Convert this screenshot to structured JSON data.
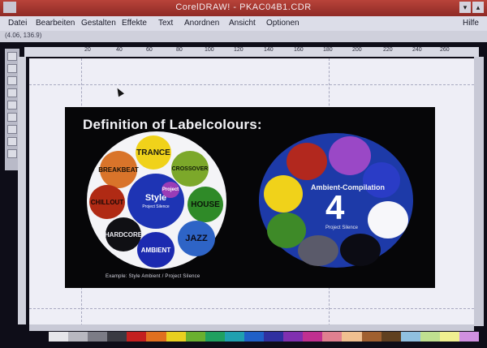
{
  "window": {
    "title": "CorelDRAW! - PKAC04B1.CDR"
  },
  "menu": {
    "items": [
      "Datei",
      "Bearbeiten",
      "Gestalten",
      "Effekte",
      "Text",
      "Anordnen",
      "Ansicht",
      "Optionen"
    ],
    "help": "Hilfe"
  },
  "status": {
    "coords": "(4.06, 136.9)"
  },
  "ruler": {
    "ticks": [
      "20",
      "40",
      "60",
      "80",
      "100",
      "120",
      "140",
      "160",
      "180",
      "200",
      "220",
      "240",
      "260"
    ]
  },
  "artwork": {
    "heading": "Definition of Labelcolours:",
    "left_labels": {
      "breakbeat": "BREAKBEAT",
      "trance": "TRANCE",
      "crossover": "CROSSOVER",
      "chillout": "CHILLOUT",
      "style": "Style",
      "project": "Project",
      "house": "HOUSE",
      "hardcore": "HARDCORE",
      "jazz": "JAZZ",
      "ambient": "AMBIENT",
      "center_small": "Project Silence"
    },
    "right_labels": {
      "title": "Ambient-Compilation",
      "number": "4",
      "subtitle": "Project Silence"
    },
    "caption": "Example: Style Ambient / Project Silence"
  },
  "colors": {
    "titlebar": "#b8433a",
    "menubar": "#dcdde8",
    "page": "#eeeef6",
    "artwork_bg": "#060608",
    "right_disc": "#1d3aa8"
  }
}
